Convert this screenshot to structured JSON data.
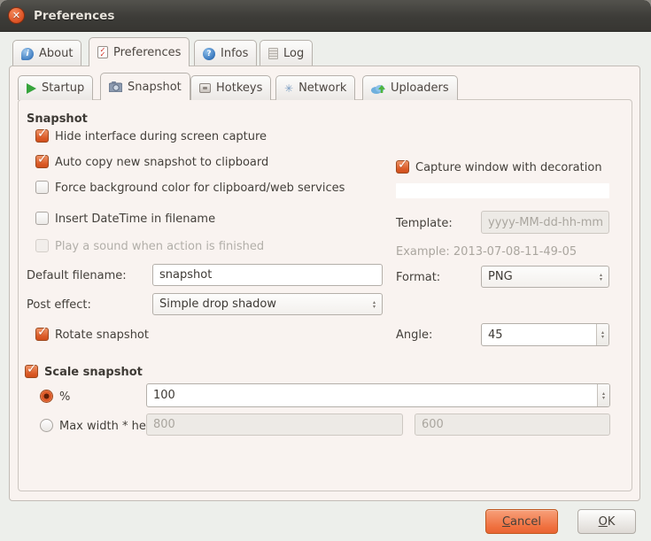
{
  "titlebar": {
    "title": "Preferences"
  },
  "icons": {
    "close": "✕",
    "check": "✓",
    "spin_up": "▴",
    "spin_down": "▾",
    "info": "i",
    "checklist": "✓",
    "help": "?",
    "network_star": "✳"
  },
  "tabs": {
    "outer": [
      {
        "label": "About",
        "icon": "info-balloon-icon"
      },
      {
        "label": "Preferences",
        "icon": "checklist-icon",
        "selected": true
      },
      {
        "label": "Infos",
        "icon": "help-icon"
      },
      {
        "label": "Log",
        "icon": "log-icon"
      }
    ],
    "inner": [
      {
        "label": "Startup",
        "icon": "play-icon"
      },
      {
        "label": "Snapshot",
        "icon": "camera-icon",
        "selected": true
      },
      {
        "label": "Hotkeys",
        "icon": "key-icon"
      },
      {
        "label": "Network",
        "icon": "network-icon"
      },
      {
        "label": "Uploaders",
        "icon": "cloud-upload-icon"
      }
    ]
  },
  "snapshot": {
    "group_title": "Snapshot",
    "cb_hide_interface": "Hide interface during screen capture",
    "cb_auto_copy": "Auto copy new snapshot to clipboard",
    "cb_force_bg": "Force background color for clipboard/web services",
    "cb_insert_datetime": "Insert DateTime in filename",
    "cb_play_sound": "Play a sound when action is finished",
    "default_filename_label": "Default filename:",
    "default_filename_value": "snapshot",
    "post_effect_label": "Post effect:",
    "post_effect_value": "Simple drop shadow",
    "cb_rotate": "Rotate snapshot",
    "cb_capture_decoration": "Capture window with decoration",
    "background_color": "#ffffff",
    "template_label": "Template:",
    "template_value": "yyyy-MM-dd-hh-mm-ss",
    "example_text": "Example: 2013-07-08-11-49-05",
    "format_label": "Format:",
    "format_value": "PNG",
    "angle_label": "Angle:",
    "angle_value": "45"
  },
  "scale": {
    "group_title": "Scale snapshot",
    "percent_label": "%",
    "percent_value": "100",
    "maxwh_label": "Max width * height",
    "max_width_value": "800",
    "max_height_value": "600"
  },
  "buttons": {
    "cancel": "Cancel",
    "ok": "OK"
  },
  "colors": {
    "accent": "#dd5c27",
    "titlebar": "#3c3b37",
    "page_bg": "#f9f3f0"
  }
}
